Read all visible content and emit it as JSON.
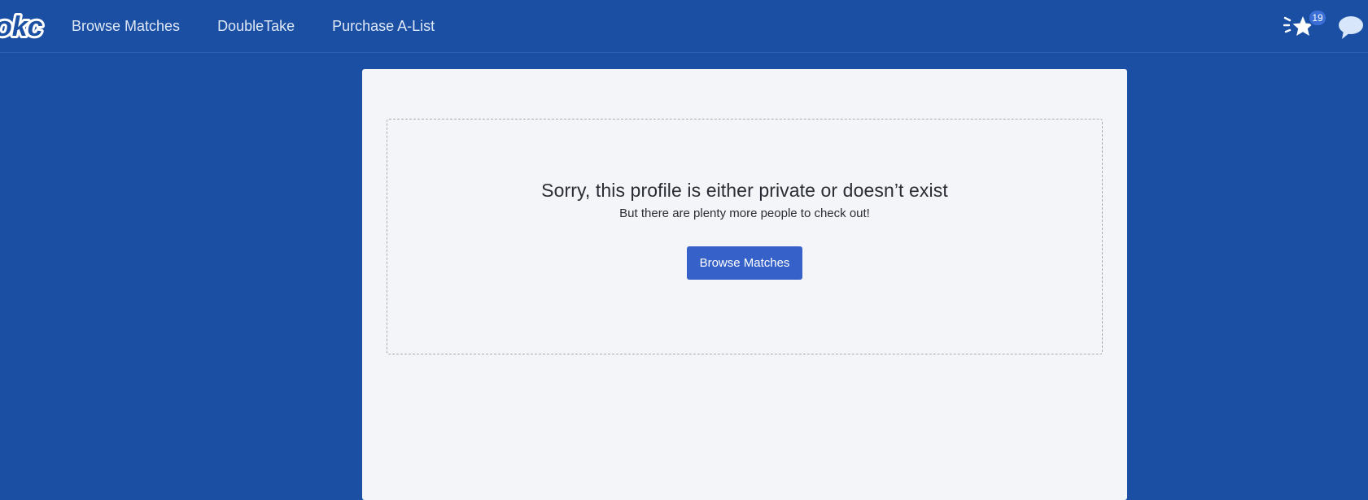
{
  "header": {
    "logo_text": "okc",
    "nav": [
      {
        "label": "Browse Matches"
      },
      {
        "label": "DoubleTake"
      },
      {
        "label": "Purchase A-List"
      }
    ],
    "likes_icon": "star-icon",
    "likes_count": "19",
    "messages_icon": "chat-bubble-icon"
  },
  "main": {
    "title": "Sorry, this profile is either private or doesn’t exist",
    "subtitle": "But there are plenty more people to check out!",
    "button_label": "Browse Matches"
  },
  "colors": {
    "header_bg": "#1a4fa3",
    "card_bg": "#f3f5f9",
    "button_bg": "#3561c8",
    "badge_bg": "#3b6fd6"
  }
}
